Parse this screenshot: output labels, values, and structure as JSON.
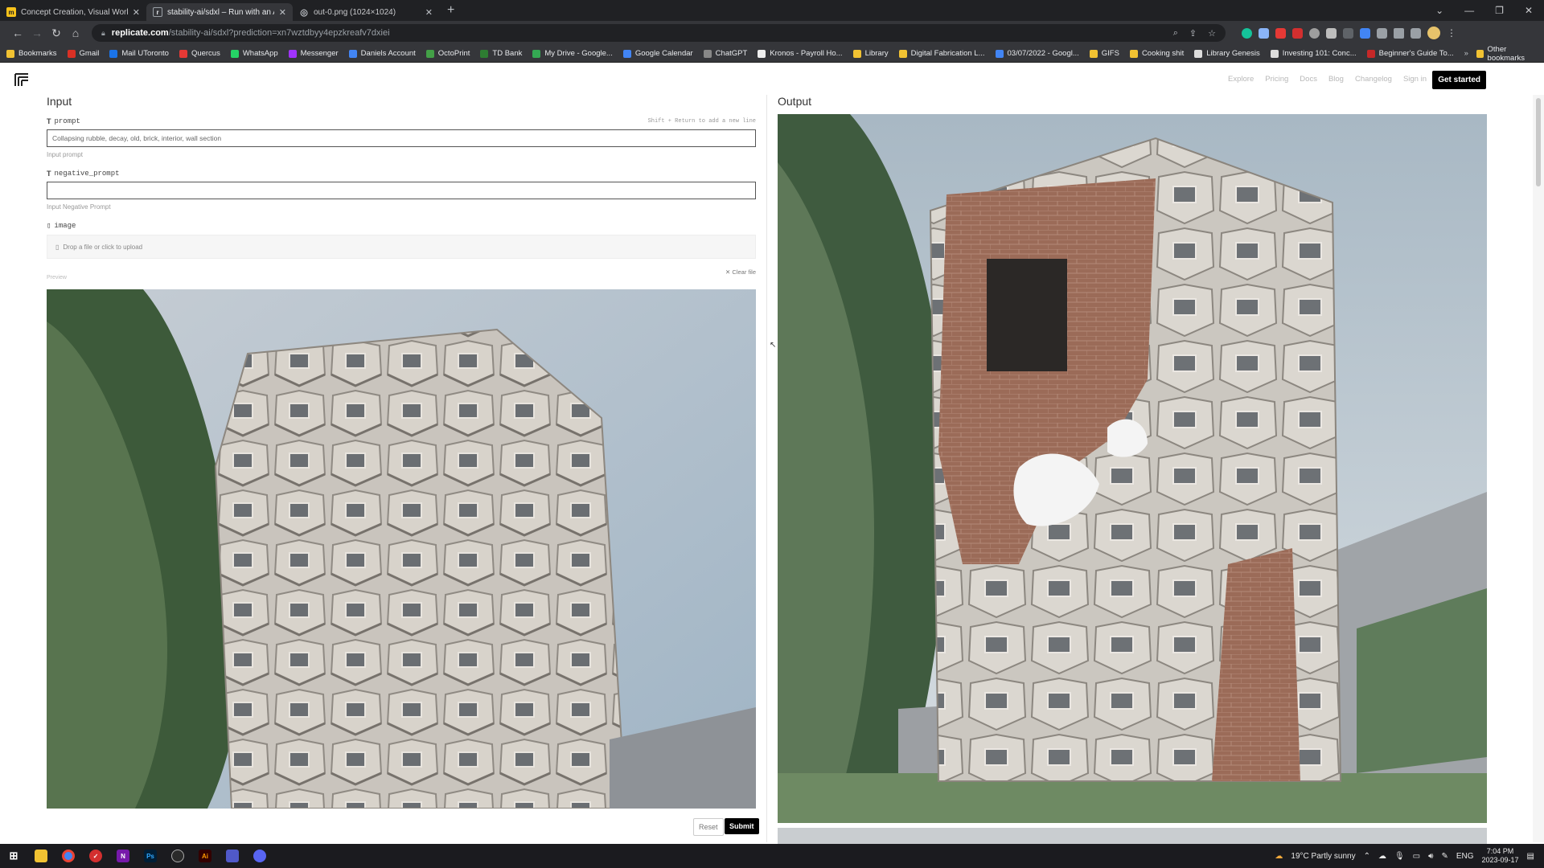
{
  "browser": {
    "tabs": [
      {
        "title": "Concept Creation, Visual Worksp",
        "icon": "miro-icon",
        "active": false
      },
      {
        "title": "stability-ai/sdxl – Run with an AP",
        "icon": "replicate-icon",
        "active": true
      },
      {
        "title": "out-0.png (1024×1024)",
        "icon": "globe-icon",
        "active": false
      }
    ],
    "url_host": "replicate.com",
    "url_path": "/stability-ai/sdxl?prediction=xn7wztdbyy4epzkreafv7dxiei",
    "bookmarks": [
      {
        "label": "Bookmarks",
        "color": "#f1c232"
      },
      {
        "label": "Gmail",
        "color": "#d93025"
      },
      {
        "label": "Mail UToronto",
        "color": "#1a73e8"
      },
      {
        "label": "Quercus",
        "color": "#e53935"
      },
      {
        "label": "WhatsApp",
        "color": "#25d366"
      },
      {
        "label": "Messenger",
        "color": "#a033ff"
      },
      {
        "label": "Daniels Account",
        "color": "#4285f4"
      },
      {
        "label": "OctoPrint",
        "color": "#43a047"
      },
      {
        "label": "TD Bank",
        "color": "#2e7d32"
      },
      {
        "label": "My Drive - Google...",
        "color": "#34a853"
      },
      {
        "label": "Google Calendar",
        "color": "#4285f4"
      },
      {
        "label": "ChatGPT",
        "color": "#888888"
      },
      {
        "label": "Kronos - Payroll Ho...",
        "color": "#eeeeee"
      },
      {
        "label": "Library",
        "color": "#f1c232"
      },
      {
        "label": "Digital Fabrication L...",
        "color": "#f1c232"
      },
      {
        "label": "03/07/2022 - Googl...",
        "color": "#4285f4"
      },
      {
        "label": "GIFS",
        "color": "#f1c232"
      },
      {
        "label": "Cooking shit",
        "color": "#f1c232"
      },
      {
        "label": "Library Genesis",
        "color": "#dddddd"
      },
      {
        "label": "Investing 101: Conc...",
        "color": "#dddddd"
      },
      {
        "label": "Beginner's Guide To...",
        "color": "#c62828"
      }
    ],
    "other_bookmarks": "Other bookmarks"
  },
  "site": {
    "nav": [
      "Explore",
      "Pricing",
      "Docs",
      "Blog",
      "Changelog",
      "Sign in"
    ],
    "get_started": "Get started"
  },
  "input": {
    "title": "Input",
    "prompt_label": "prompt",
    "prompt_hint": "Shift + Return to add a new line",
    "prompt_value": "Collapsing rubble, decay, old, brick, interior, wall section",
    "prompt_help": "Input prompt",
    "negative_label": "negative_prompt",
    "negative_value": "",
    "negative_help": "Input Negative Prompt",
    "image_label": "image",
    "upload_text": "Drop a file or click to upload",
    "preview_label": "Preview",
    "clear_file": "Clear file",
    "reset": "Reset",
    "submit": "Submit"
  },
  "output": {
    "title": "Output"
  },
  "taskbar": {
    "weather": "19°C  Partly sunny",
    "lang": "ENG",
    "time": "7:04 PM",
    "date": "2023-09-17"
  }
}
